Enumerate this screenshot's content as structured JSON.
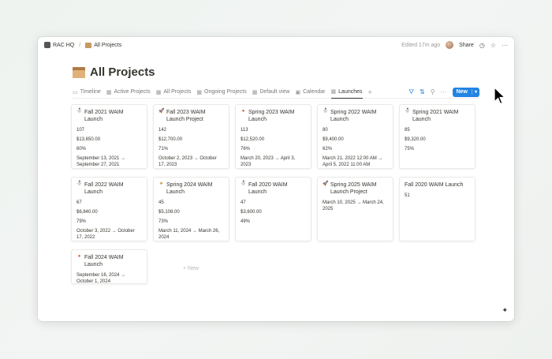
{
  "breadcrumb": {
    "workspace": "RAC HQ",
    "separator": "/",
    "page": "All Projects"
  },
  "topbar": {
    "edited": "Edited 17m ago",
    "share": "Share"
  },
  "page": {
    "title": "All Projects"
  },
  "tabs": [
    {
      "label": "Timeline",
      "icon": "timeline-icon",
      "glyph": "▭"
    },
    {
      "label": "Active Projects",
      "icon": "table-icon",
      "glyph": "▦"
    },
    {
      "label": "All Projects",
      "icon": "table-icon",
      "glyph": "▦"
    },
    {
      "label": "Ongoing Projects",
      "icon": "board-icon",
      "glyph": "▦"
    },
    {
      "label": "Default view",
      "icon": "table-icon",
      "glyph": "▦"
    },
    {
      "label": "Calendar",
      "icon": "calendar-icon",
      "glyph": "▣"
    },
    {
      "label": "Launches",
      "icon": "gallery-icon",
      "glyph": "▦"
    }
  ],
  "toolbar": {
    "new_label": "New",
    "accent": "#2383e2"
  },
  "cards": [
    {
      "title": "Fall 2021 WAIM Launch",
      "icon": "snowman-icon",
      "glyph": "⛄",
      "cls": "snow",
      "count": "107",
      "budget": "$13,650.00",
      "pct": "60%",
      "dates": "September 13, 2021 → September 27, 2021"
    },
    {
      "title": "Fall 2023 WAIM Launch Project",
      "icon": "rocket-icon",
      "glyph": "🚀",
      "cls": "rocket",
      "count": "142",
      "budget": "$12,700.00",
      "pct": "71%",
      "dates": "October 2, 2023 → October 17, 2023"
    },
    {
      "title": "Spring 2023 WAIM Launch",
      "icon": "fall-leaf-icon",
      "glyph": "●",
      "cls": "fall",
      "count": "113",
      "budget": "$12,520.00",
      "pct": "76%",
      "dates": "March 20, 2023 → April 3, 2023"
    },
    {
      "title": "Spring 2022 WAIM Launch",
      "icon": "snowman-icon",
      "glyph": "⛄",
      "cls": "snow",
      "count": "80",
      "budget": "$9,400.00",
      "pct": "62%",
      "dates": "March 21, 2022 12:00 AM → April 5, 2022 11:00 AM"
    },
    {
      "title": "Spring 2021 WAIM Launch",
      "icon": "snowman-icon",
      "glyph": "⛄",
      "cls": "snow",
      "count": "85",
      "budget": "$9,320.00",
      "pct": "75%",
      "dates": ""
    },
    {
      "title": "Fall 2022 WAIM Launch",
      "icon": "snowman-icon",
      "glyph": "⛄",
      "cls": "snow",
      "count": "67",
      "budget": "$6,840.00",
      "pct": "79%",
      "dates": "October 3, 2022 → October 17, 2022"
    },
    {
      "title": "Spring 2024 WAIM Launch",
      "icon": "plant-icon",
      "glyph": "♣",
      "cls": "plant",
      "count": "45",
      "budget": "$5,108.00",
      "pct": "73%",
      "dates": "March 11, 2024 → March 26, 2024"
    },
    {
      "title": "Fall 2020 WAIM Launch",
      "icon": "snowman-icon",
      "glyph": "⛄",
      "cls": "snow",
      "count": "47",
      "budget": "$3,600.00",
      "pct": "49%",
      "dates": ""
    },
    {
      "title": "Spring 2025 WAIM Launch Project",
      "icon": "rocket-icon",
      "glyph": "🚀",
      "cls": "rocket",
      "count": "",
      "budget": "",
      "pct": "",
      "dates": "March 10, 2025 → March 24, 2025"
    },
    {
      "title": "Fall 2020 WAIM Launch",
      "icon": "",
      "glyph": "",
      "cls": "",
      "count": "51",
      "budget": "",
      "pct": "",
      "dates": ""
    },
    {
      "title": "Fall 2024 WAIM Launch",
      "icon": "fall-leaf-icon",
      "glyph": "●",
      "cls": "fall",
      "count": "",
      "budget": "",
      "pct": "",
      "dates": "September 16, 2024 → October 1, 2024"
    }
  ],
  "add_new": "+ New"
}
